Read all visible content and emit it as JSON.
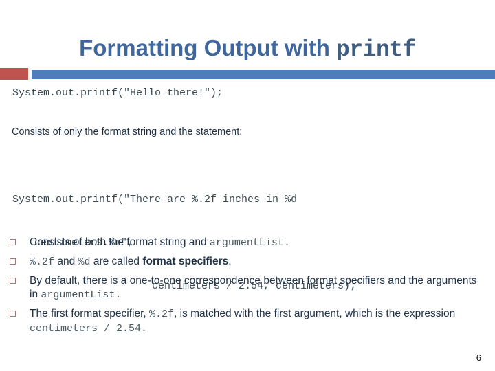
{
  "slide": {
    "title_text": "Formatting Output with ",
    "title_code": "printf",
    "page_number": "6",
    "code_line_1": "System.out.printf(\"Hello there!\");",
    "statement_text": "Consists of only the format string and the statement:",
    "code_block": {
      "line_1": "System.out.printf(\"There are %.2f inches in %d",
      "line_2": "centimeters.%n\",",
      "line_3": "centimeters / 2.54, centimeters);"
    },
    "bullets": [
      {
        "segments": [
          {
            "text": "Consists of both the format string and ",
            "style": "plain"
          },
          {
            "text": "argumentList.",
            "style": "mono"
          }
        ]
      },
      {
        "segments": [
          {
            "text": "%.2f",
            "style": "mono"
          },
          {
            "text": " and ",
            "style": "plain"
          },
          {
            "text": "%d",
            "style": "mono"
          },
          {
            "text": " are called ",
            "style": "plain"
          },
          {
            "text": "format specifiers",
            "style": "bold"
          },
          {
            "text": ".",
            "style": "plain"
          }
        ]
      },
      {
        "segments": [
          {
            "text": "By default, there is a one-to-one correspondence between format specifiers and the arguments in ",
            "style": "plain"
          },
          {
            "text": "argumentList.",
            "style": "mono"
          }
        ]
      },
      {
        "segments": [
          {
            "text": "The first format specifier, ",
            "style": "plain"
          },
          {
            "text": "%.2f",
            "style": "mono"
          },
          {
            "text": ", is matched with the first argument, which is the expression ",
            "style": "plain"
          },
          {
            "text": "centimeters / 2.54.",
            "style": "mono"
          }
        ]
      }
    ],
    "colors": {
      "title_blue": "#3f679e",
      "bar_red": "#bf5350",
      "bar_blue": "#4d7ebb",
      "body_navy": "#1f3147",
      "code_slate": "#3a4a52",
      "bullet_marker": "#9d7c7c"
    }
  }
}
